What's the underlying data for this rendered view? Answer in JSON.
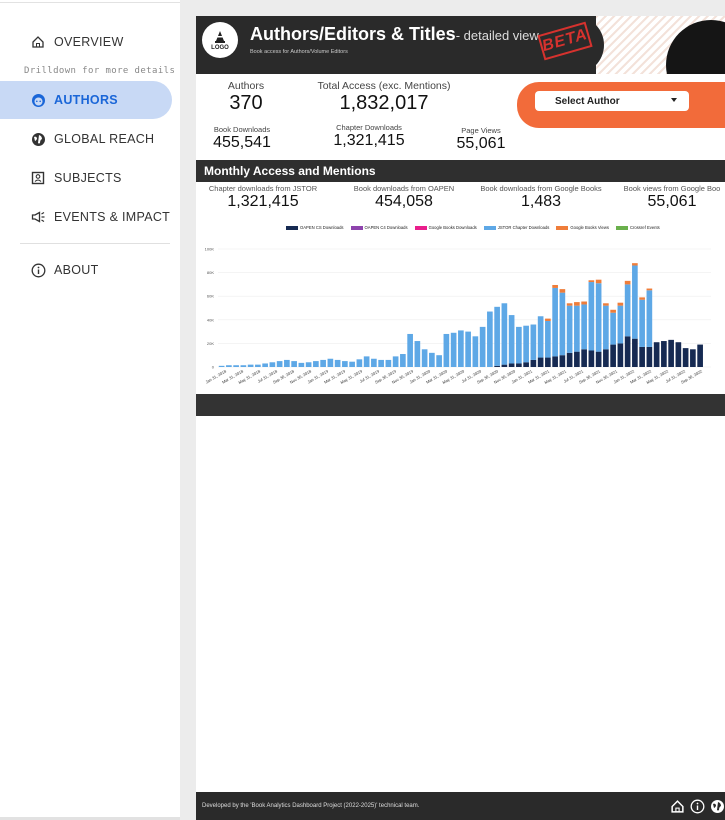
{
  "sidebar": {
    "items": [
      {
        "label": "OVERVIEW",
        "icon": "home-icon"
      },
      {
        "label": "AUTHORS",
        "icon": "face-icon"
      },
      {
        "label": "GLOBAL REACH",
        "icon": "globe-icon"
      },
      {
        "label": "SUBJECTS",
        "icon": "subject-icon"
      },
      {
        "label": "EVENTS & IMPACT",
        "icon": "megaphone-icon"
      },
      {
        "label": "ABOUT",
        "icon": "info-icon"
      }
    ],
    "drilldown_note": "Drilldown for more details",
    "active": "AUTHORS"
  },
  "header": {
    "logo_text": "LOGO",
    "title": "Authors/Editors & Titles",
    "subtitle": "- detailed view",
    "tagline": "Book access for Authors/Volume Editors",
    "badge": "BETA"
  },
  "kpis": {
    "authors": {
      "label": "Authors",
      "value": "370"
    },
    "total_access": {
      "label": "Total Access (exc. Mentions)",
      "value": "1,832,017"
    },
    "book_downloads": {
      "label": "Book Downloads",
      "value": "455,541"
    },
    "chapter_downloads": {
      "label": "Chapter Downloads",
      "value": "1,321,415"
    },
    "page_views": {
      "label": "Page Views",
      "value": "55,061"
    }
  },
  "select_author": {
    "label": "Select Author"
  },
  "monthly": {
    "title": "Monthly Access and Mentions",
    "metrics": [
      {
        "label": "Chapter downloads from JSTOR",
        "value": "1,321,415"
      },
      {
        "label": "Book downloads from OAPEN",
        "value": "454,058"
      },
      {
        "label": "Book downloads from Google Books",
        "value": "1,483"
      },
      {
        "label": "Book views from Google Boo",
        "value": "55,061"
      }
    ]
  },
  "colors": {
    "oapen_cs": "#162a52",
    "oapen_c4": "#8e44ad",
    "google_downloads": "#e91e8c",
    "jstor": "#5ea8e6",
    "google_views": "#ef7d3a",
    "crossref": "#6ab04c",
    "accent_orange": "#f26b3a",
    "active_nav": "#1a66d8"
  },
  "chart_data": {
    "type": "bar",
    "stacked": true,
    "legend": [
      "OAPEN CS Downloads",
      "OAPEN C4 Downloads",
      "Google Books Downloads",
      "JSTOR Chapter Downloads",
      "Google Books Views",
      "Crossref Events"
    ],
    "yticks": [
      "0",
      "20K",
      "40K",
      "60K",
      "80K",
      "100K"
    ],
    "ylim": [
      0,
      100000
    ],
    "xticks": [
      "Jan 31, 2018",
      "Mar 31, 2018",
      "May 31, 2018",
      "Jul 31, 2018",
      "Sep 30, 2018",
      "Nov 30, 2018",
      "Jan 31, 2019",
      "Mar 31, 2019",
      "May 31, 2019",
      "Jul 31, 2019",
      "Sep 30, 2019",
      "Nov 30, 2019",
      "Jan 31, 2020",
      "Mar 31, 2020",
      "May 31, 2020",
      "Jul 31, 2020",
      "Sep 30, 2020",
      "Nov 30, 2020",
      "Jan 31, 2021",
      "Mar 31, 2021",
      "May 31, 2021",
      "Jul 31, 2021",
      "Sep 30, 2021",
      "Nov 30, 2021",
      "Jan 31, 2022",
      "Mar 31, 2022",
      "May 31, 2022",
      "Jul 31, 2022",
      "Sep 30, 2022"
    ],
    "series": [
      {
        "name": "OAPEN CS Downloads",
        "color": "#162a52",
        "values": [
          0,
          0,
          0,
          0,
          0,
          0,
          0,
          0,
          0,
          0,
          0,
          0,
          0,
          0,
          0,
          0,
          0,
          0,
          0,
          0,
          0,
          0,
          0,
          0,
          0,
          0,
          0,
          0,
          0,
          0,
          0,
          0,
          0,
          0,
          0,
          0,
          0,
          0,
          1000,
          2000,
          3000,
          3000,
          4000,
          6000,
          8000,
          8000,
          9000,
          10000,
          12000,
          13000,
          15000,
          14000,
          13000,
          15000,
          19000,
          20000,
          26000,
          24000,
          17000,
          17000,
          21000,
          22000,
          23000,
          21000,
          16000,
          15000,
          19000,
          0
        ]
      },
      {
        "name": "JSTOR Chapter Downloads",
        "color": "#5ea8e6",
        "values": [
          1000,
          1500,
          1500,
          1500,
          2000,
          2000,
          3000,
          4000,
          5000,
          6000,
          5000,
          3500,
          4000,
          5000,
          6000,
          7000,
          6000,
          5000,
          4500,
          6500,
          9000,
          7000,
          6000,
          6000,
          9000,
          11000,
          28000,
          22000,
          15000,
          12000,
          10000,
          28000,
          29000,
          31000,
          30000,
          26000,
          34000,
          47000,
          50000,
          52000,
          41000,
          31000,
          31000,
          30000,
          35000,
          31000,
          58000,
          53000,
          40000,
          39000,
          38000,
          58000,
          58000,
          37000,
          27000,
          32000,
          44000,
          62000,
          40000,
          48000
        ]
      },
      {
        "name": "Google Books Views",
        "color": "#ef7d3a",
        "values": [
          0,
          0,
          0,
          0,
          0,
          0,
          0,
          0,
          0,
          0,
          0,
          0,
          0,
          0,
          0,
          0,
          0,
          0,
          0,
          0,
          0,
          0,
          0,
          0,
          0,
          0,
          0,
          0,
          0,
          0,
          0,
          0,
          0,
          0,
          0,
          0,
          0,
          0,
          0,
          0,
          0,
          0,
          0,
          0,
          0,
          2000,
          2500,
          3000,
          2000,
          3000,
          2500,
          1500,
          3000,
          2000,
          2500,
          2500,
          3000,
          2000,
          2000,
          1500
        ]
      }
    ]
  },
  "footer": {
    "text": "Developed by the 'Book Analytics Dashboard Project (2022-2025)' technical team."
  }
}
